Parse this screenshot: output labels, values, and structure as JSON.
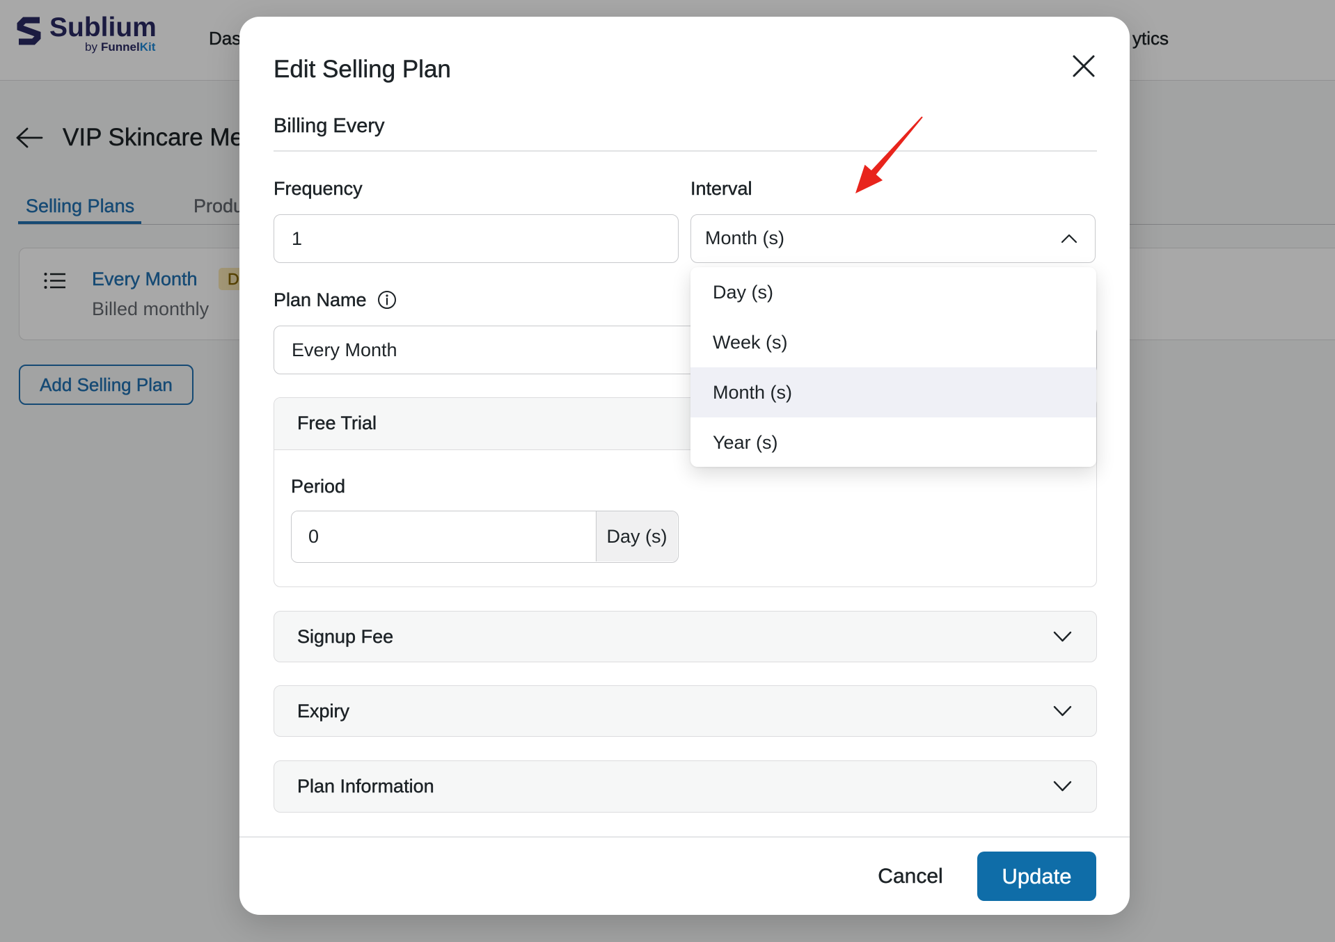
{
  "app": {
    "logo": {
      "name": "Sublium",
      "byline_prefix": "by",
      "byline_brand": "Funnel",
      "byline_accent": "Kit",
      "icon": "sublium-logo-icon"
    },
    "nav": {
      "left_item": "Das",
      "right_item": "ytics"
    },
    "back_icon": "arrow-left-icon",
    "page_title": "VIP Skincare Me",
    "tabs": [
      {
        "label": "Selling Plans",
        "active": true
      },
      {
        "label": "Produ",
        "active": false
      }
    ],
    "plan_card": {
      "icon": "list-icon",
      "name": "Every Month",
      "badge": "D",
      "subtitle": "Billed monthly"
    },
    "add_plan_button": "Add Selling Plan"
  },
  "modal": {
    "title": "Edit Selling Plan",
    "close_icon": "close-icon",
    "section_title": "Billing Every",
    "frequency": {
      "label": "Frequency",
      "value": "1"
    },
    "interval": {
      "label": "Interval",
      "value": "Month (s)",
      "open": true,
      "icon": "chevron-up-icon",
      "options": [
        "Day (s)",
        "Week (s)",
        "Month (s)",
        "Year (s)"
      ],
      "highlighted": "Month (s)"
    },
    "plan_name": {
      "label": "Plan Name",
      "info_icon": "info-icon",
      "value": "Every Month"
    },
    "free_trial": {
      "label": "Free Trial",
      "expanded": true,
      "period_label": "Period",
      "period_value": "0",
      "period_unit": "Day (s)"
    },
    "accordions": [
      {
        "label": "Signup Fee",
        "expanded": false,
        "icon": "chevron-down-icon"
      },
      {
        "label": "Expiry",
        "expanded": false,
        "icon": "chevron-down-icon"
      },
      {
        "label": "Plan Information",
        "expanded": false,
        "icon": "chevron-down-icon"
      }
    ],
    "footer": {
      "cancel_label": "Cancel",
      "update_label": "Update"
    }
  },
  "colors": {
    "accent": "#2271b1",
    "primary_button": "#0f6da8",
    "logo": "#2a2963",
    "annotation_arrow": "#e8241c"
  }
}
